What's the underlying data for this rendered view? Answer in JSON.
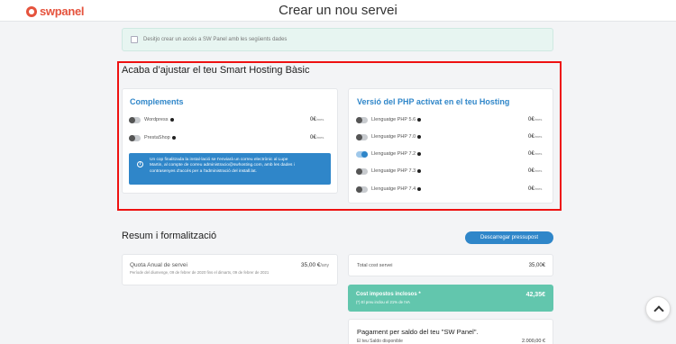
{
  "header": {
    "logo": "swpanel",
    "title": "Crear un nou servei"
  },
  "access_info": {
    "checkbox_label": "Desitjo crear un accés a SW Panel amb les següents dades"
  },
  "adjust": {
    "heading": "Acaba d’ajustar el teu Smart Hosting Bàsic",
    "complements": {
      "title": "Complements",
      "items": [
        {
          "label": "Wordpress",
          "price": "0€",
          "unit": "/mes",
          "enabled": false
        },
        {
          "label": "PrestaShop",
          "price": "0€",
          "unit": "/mes",
          "enabled": false
        }
      ],
      "notice": {
        "line1": "Un cop finalitzada la instal·lació se t'enviarà un correu electrònic al Lupe",
        "line2": "Martin, al compte de correu administracio@swhosting.com, amb les dades i",
        "line3": "contrasenyes d'accés per a l'administració del install.lat."
      }
    },
    "php": {
      "title": "Versió del PHP activat en el teu Hosting",
      "items": [
        {
          "label": "Llenguatge PHP 5.6",
          "price": "0€",
          "unit": "/mes",
          "enabled": false
        },
        {
          "label": "Llenguatge PHP 7.0",
          "price": "0€",
          "unit": "/mes",
          "enabled": false
        },
        {
          "label": "Llenguatge PHP 7.2",
          "price": "0€",
          "unit": "/mes",
          "enabled": true
        },
        {
          "label": "Llenguatge PHP 7.3",
          "price": "0€",
          "unit": "/mes",
          "enabled": false
        },
        {
          "label": "Llenguatge PHP 7.4",
          "price": "0€",
          "unit": "/mes",
          "enabled": false
        }
      ]
    }
  },
  "summary": {
    "heading": "Resum i formalització",
    "download_button": "Descarregar pressupost",
    "quota": {
      "title": "Quota Anual de servei",
      "price": "35,00 €",
      "unit": "/any",
      "period": "Període del diumenge, 09 de febrer de 2020 fins el dimarts, 09 de febrer de 2021"
    },
    "total": {
      "label": "Total cost servei",
      "value": "35,00€"
    },
    "tax": {
      "label": "Cost impostos inclosos *",
      "value": "42,35€",
      "note": "(*) El preu inclou el 21% de IVA"
    },
    "payment": {
      "title": "Pagament per saldo del teu \"SW Panel\".",
      "balance_label": "El teu Saldo disponible",
      "balance_value": "2.000,00 €"
    }
  }
}
